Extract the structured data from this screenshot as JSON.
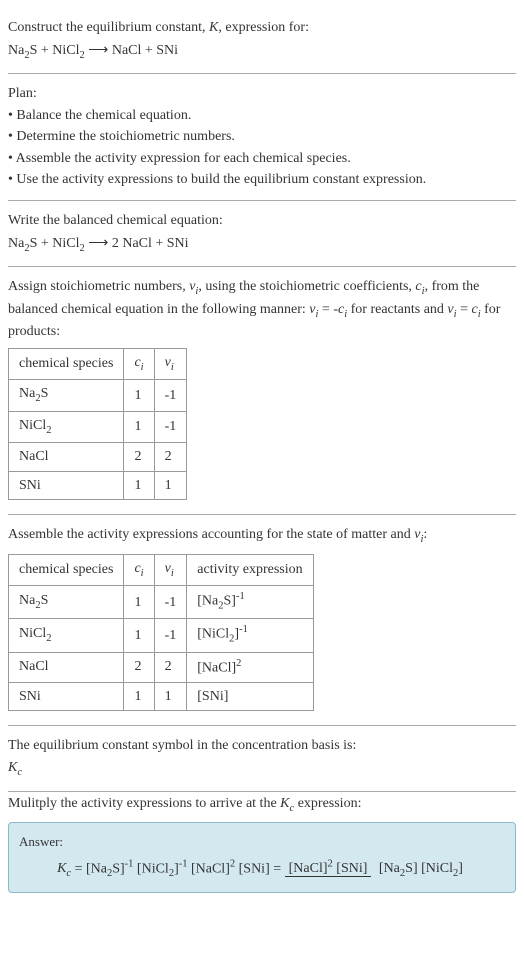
{
  "intro": {
    "line1": "Construct the equilibrium constant, K, expression for:",
    "equation": "Na₂S + NiCl₂ ⟶ NaCl + SNi"
  },
  "plan": {
    "title": "Plan:",
    "items": [
      "• Balance the chemical equation.",
      "• Determine the stoichiometric numbers.",
      "• Assemble the activity expression for each chemical species.",
      "• Use the activity expressions to build the equilibrium constant expression."
    ]
  },
  "balanced": {
    "title": "Write the balanced chemical equation:",
    "equation": "Na₂S + NiCl₂ ⟶ 2 NaCl + SNi"
  },
  "assign": {
    "text": "Assign stoichiometric numbers, νᵢ, using the stoichiometric coefficients, cᵢ, from the balanced chemical equation in the following manner: νᵢ = -cᵢ for reactants and νᵢ = cᵢ for products:",
    "headers": [
      "chemical species",
      "cᵢ",
      "νᵢ"
    ],
    "rows": [
      [
        "Na₂S",
        "1",
        "-1"
      ],
      [
        "NiCl₂",
        "1",
        "-1"
      ],
      [
        "NaCl",
        "2",
        "2"
      ],
      [
        "SNi",
        "1",
        "1"
      ]
    ]
  },
  "assemble": {
    "text": "Assemble the activity expressions accounting for the state of matter and νᵢ:",
    "headers": [
      "chemical species",
      "cᵢ",
      "νᵢ",
      "activity expression"
    ],
    "rows": [
      [
        "Na₂S",
        "1",
        "-1",
        "[Na₂S]⁻¹"
      ],
      [
        "NiCl₂",
        "1",
        "-1",
        "[NiCl₂]⁻¹"
      ],
      [
        "NaCl",
        "2",
        "2",
        "[NaCl]²"
      ],
      [
        "SNi",
        "1",
        "1",
        "[SNi]"
      ]
    ]
  },
  "symbol": {
    "line1": "The equilibrium constant symbol in the concentration basis is:",
    "line2": "K𝒸"
  },
  "multiply": {
    "text": "Mulitply the activity expressions to arrive at the K𝒸 expression:"
  },
  "answer": {
    "label": "Answer:",
    "lhs": "K𝒸 = [Na₂S]⁻¹ [NiCl₂]⁻¹ [NaCl]² [SNi] = ",
    "num": "[NaCl]² [SNi]",
    "den": "[Na₂S] [NiCl₂]"
  }
}
